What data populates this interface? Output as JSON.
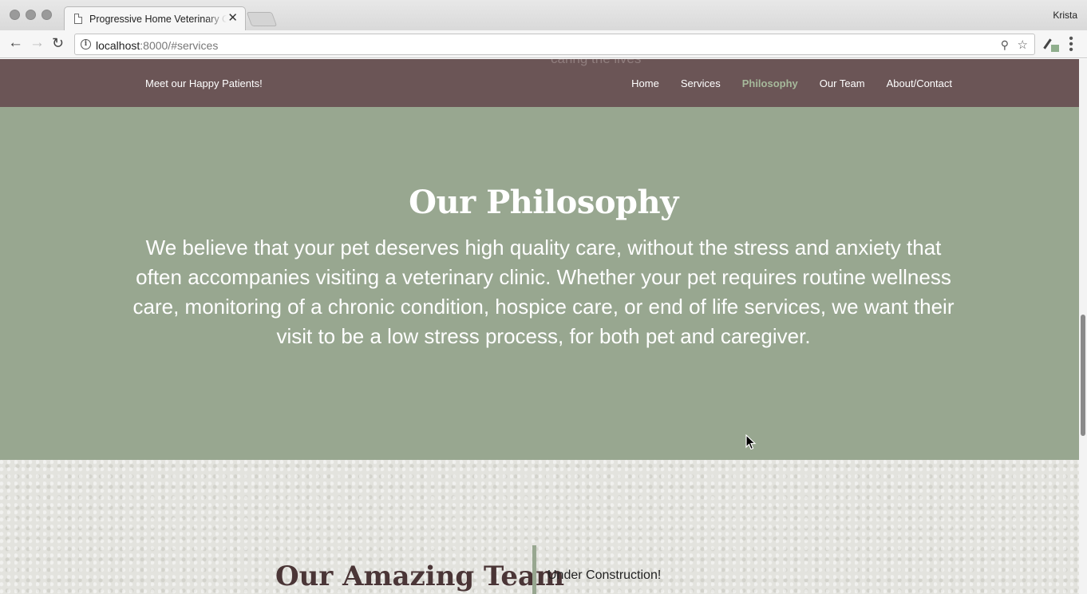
{
  "browser": {
    "tab_title": "Progressive Home Veterinary Care",
    "tab_close": "✕",
    "profile_name": "Krista",
    "url_host": "localhost",
    "url_rest": ":8000/#services",
    "icons": {
      "back": "arrow-left-icon",
      "forward": "arrow-right-icon",
      "reload": "reload-icon",
      "info": "info-icon",
      "zoom": "zoom-out-icon",
      "bookmark": "star-icon",
      "extension": "eyedropper-icon",
      "menu": "kebab-menu-icon"
    }
  },
  "site_nav": {
    "partial_text_behind": "caring the lives",
    "brand_link": "Meet our Happy Patients!",
    "links": [
      {
        "label": "Home",
        "active": false
      },
      {
        "label": "Services",
        "active": false
      },
      {
        "label": "Philosophy",
        "active": true
      },
      {
        "label": "Our Team",
        "active": false
      },
      {
        "label": "About/Contact",
        "active": false
      }
    ]
  },
  "philosophy": {
    "title": "Our Philosophy",
    "body": "We believe that your pet deserves high quality care, without the stress and anxiety that often accompanies visiting a veterinary clinic. Whether your pet requires routine wellness care, monitoring of a chronic condition, hospice care, or end of life services, we want their visit to be a low stress process, for both pet and caregiver."
  },
  "team": {
    "title": "Our Amazing Team",
    "note": "Under Construction!"
  },
  "colors": {
    "nav_bg": "#6b5556",
    "nav_active": "#a6b99b",
    "philosophy_bg": "#98a790",
    "team_title": "#4a3536"
  }
}
